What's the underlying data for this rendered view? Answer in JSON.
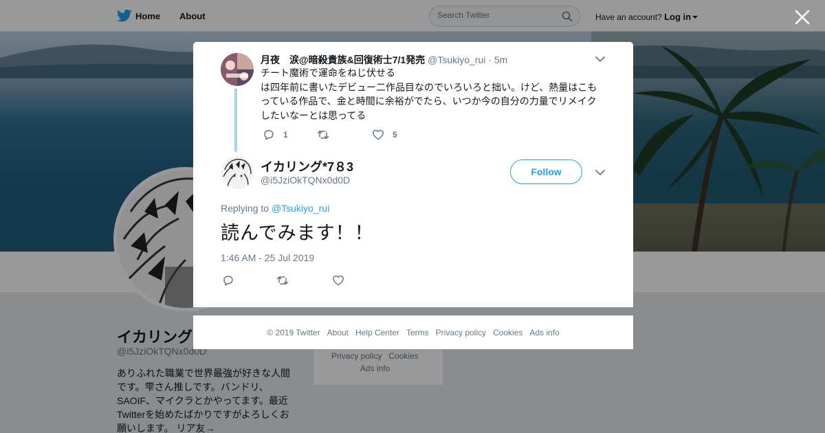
{
  "topbar": {
    "home_label": "Home",
    "about_label": "About",
    "search_placeholder": "Search Twitter",
    "have_account": "Have an account?",
    "login_label": "Log in"
  },
  "profile": {
    "name": "イカリング",
    "handle": "@i5JziOkTQNx0d0D",
    "bio": "ありふれた職業で世界最強が好きな人間です。雫さん推しです。バンドリ、SAOIF、マイクラとかやってます。最近Twitterを始めたばかりですがよろしくお願いします。 リア友→"
  },
  "bg_footer": {
    "privacy": "Privacy policy",
    "cookies": "Cookies",
    "ads": "Ads info"
  },
  "parent_tweet": {
    "author_name": "月夜　涙@暗殺貴族&回復術士7/1発売",
    "author_handle": "@Tsukiyo_rui",
    "time": "· 5m",
    "text_line1": "チート魔術で運命をねじ伏せる",
    "text_rest": "は四年前に書いたデビュー二作品目なのでいろいろと拙い。けど、熱量はこもっている作品で、金と時間に余裕がでたら、いつか今の自分の力量でリメイクしたいなーとは思ってる",
    "reply_count": "1",
    "retweet_count": "",
    "like_count": "5"
  },
  "main_tweet": {
    "author_name": "イカリング*7８3",
    "author_handle": "@i5JziOkTQNx0d0D",
    "follow_label": "Follow",
    "replying_prefix": "Replying to",
    "replying_to": "@Tsukiyo_rui",
    "text": "読んでみます！！",
    "timestamp": "1:46 AM - 25 Jul 2019"
  },
  "footer": {
    "copyright": "© 2019 Twitter",
    "about": "About",
    "help": "Help Center",
    "terms": "Terms",
    "privacy": "Privacy policy",
    "cookies": "Cookies",
    "ads": "Ads info"
  },
  "colors": {
    "brand": "#1da1f2",
    "thread_line": "#a8d4f2",
    "muted_text": "#657786"
  }
}
